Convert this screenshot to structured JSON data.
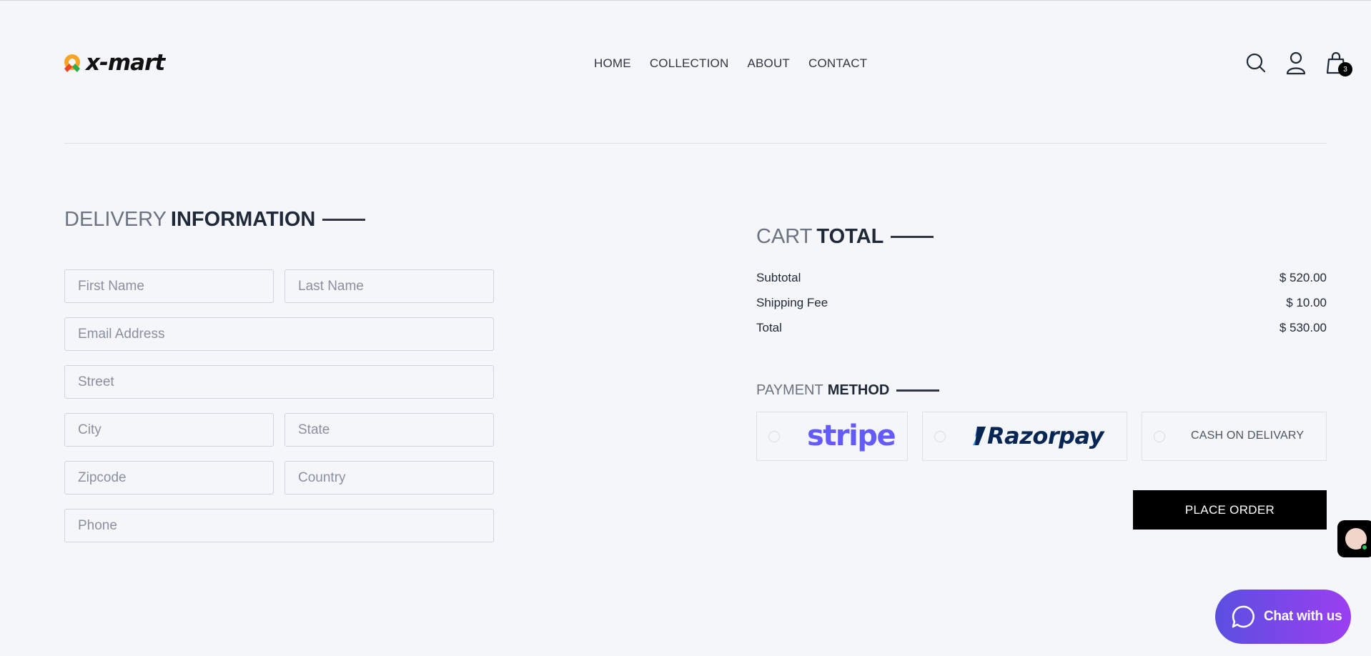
{
  "brand": {
    "name": "x-mart"
  },
  "nav": {
    "items": [
      {
        "label": "HOME"
      },
      {
        "label": "COLLECTION"
      },
      {
        "label": "ABOUT"
      },
      {
        "label": "CONTACT"
      }
    ]
  },
  "header": {
    "icons": [
      "search-icon",
      "user-icon",
      "shopping-bag-icon"
    ],
    "cart_count": "3"
  },
  "delivery": {
    "title_light": "DELIVERY",
    "title_bold": "INFORMATION",
    "fields": {
      "first_name": {
        "placeholder": "First Name"
      },
      "last_name": {
        "placeholder": "Last Name"
      },
      "email": {
        "placeholder": "Email Address"
      },
      "street": {
        "placeholder": "Street"
      },
      "city": {
        "placeholder": "City"
      },
      "state": {
        "placeholder": "State"
      },
      "zipcode": {
        "placeholder": "Zipcode"
      },
      "country": {
        "placeholder": "Country"
      },
      "phone": {
        "placeholder": "Phone"
      }
    }
  },
  "cart": {
    "title_light": "CART",
    "title_bold": "TOTAL",
    "rows": [
      {
        "label": "Subtotal",
        "value": "$ 520.00"
      },
      {
        "label": "Shipping Fee",
        "value": "$ 10.00"
      },
      {
        "label": "Total",
        "value": "$ 530.00"
      }
    ]
  },
  "payment": {
    "title_light": "PAYMENT",
    "title_bold": "METHOD",
    "options": [
      {
        "label": "stripe",
        "color": "#635bff"
      },
      {
        "label": "Razorpay",
        "color": "#072654"
      },
      {
        "label": "CASH ON DELIVARY"
      }
    ]
  },
  "actions": {
    "place_order": "PLACE ORDER"
  },
  "chat": {
    "label": "Chat with us"
  },
  "colors": {
    "background": "#f5f6fa",
    "primary_button": "#000000",
    "chat_gradient_start": "#5b4fe0",
    "chat_gradient_end": "#9b3ff0"
  }
}
